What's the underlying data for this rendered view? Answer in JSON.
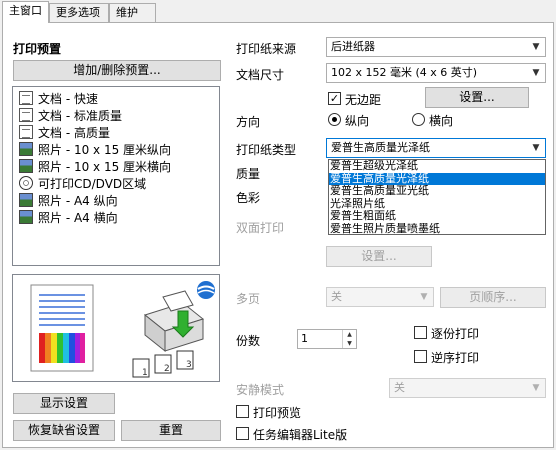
{
  "tabs": [
    "主窗口",
    "更多选项",
    "维护"
  ],
  "left": {
    "preset_title": "打印预置",
    "add_remove_button": "增加/删除预置...",
    "presets": [
      {
        "icon": "document-icon",
        "label": "文档 - 快速"
      },
      {
        "icon": "document-icon",
        "label": "文档 - 标准质量"
      },
      {
        "icon": "document-icon",
        "label": "文档 - 高质量"
      },
      {
        "icon": "photo-icon",
        "label": "照片 - 10 x 15 厘米纵向"
      },
      {
        "icon": "photo-icon",
        "label": "照片 - 10 x 15 厘米横向"
      },
      {
        "icon": "cd-icon",
        "label": "可打印CD/DVD区域"
      },
      {
        "icon": "photo-icon",
        "label": "照片 - A4 纵向"
      },
      {
        "icon": "photo-icon",
        "label": "照片 - A4 横向"
      }
    ],
    "show_settings_button": "显示设置",
    "restore_defaults_button": "恢复缺省设置",
    "reset_button": "重置"
  },
  "paper_source": {
    "label": "打印纸来源",
    "value": "后进纸器"
  },
  "document_size": {
    "label": "文档尺寸",
    "value": "102 x 152 毫米 (4 x 6 英寸)"
  },
  "borderless": {
    "label": "无边距",
    "checked": true
  },
  "settings_button": "设置...",
  "orientation": {
    "label": "方向",
    "portrait": "纵向",
    "landscape": "横向",
    "selected": "portrait"
  },
  "paper_type": {
    "label": "打印纸类型",
    "value": "爱普生高质量光泽纸",
    "options": [
      "爱普生超级光泽纸",
      "爱普生高质量光泽纸",
      "爱普生高质量亚光纸",
      "光泽照片纸",
      "爱普生粗面纸",
      "爱普生照片质量喷墨纸"
    ],
    "highlighted_index": 1
  },
  "quality_label": "质量",
  "color_label": "色彩",
  "duplex": {
    "label": "双面打印",
    "settings_button": "设置..."
  },
  "multipage": {
    "label": "多页",
    "value": "关",
    "page_order_button": "页顺序..."
  },
  "copies": {
    "label": "份数",
    "value": "1",
    "collate_label": "逐份打印",
    "reverse_label": "逆序打印",
    "collate_checked": false,
    "reverse_checked": false
  },
  "quiet_mode": {
    "label": "安静模式",
    "value": "关"
  },
  "print_preview": {
    "label": "打印预览",
    "checked": false
  },
  "job_arranger": {
    "label": "任务编辑器Lite版",
    "checked": false
  },
  "colors": {
    "accent": "#0078d7",
    "disabled_text": "#a0a0a0"
  }
}
